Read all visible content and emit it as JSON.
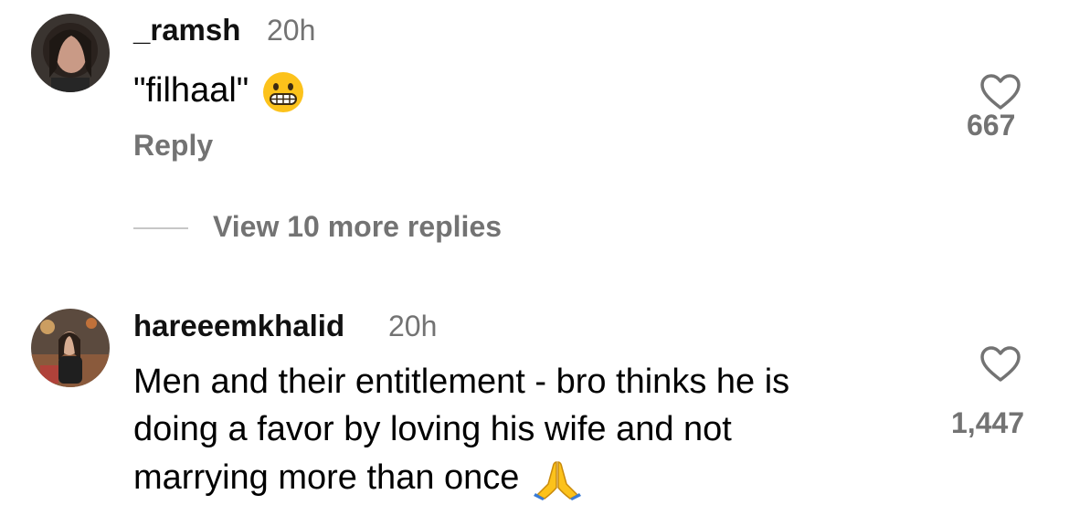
{
  "comments": [
    {
      "username": "_ramsh",
      "time": "20h",
      "lines": [
        "\"filhaal\""
      ],
      "emoji": "grimacing-face",
      "reply_label": "Reply",
      "likes": "667",
      "view_more": "View 10 more replies"
    },
    {
      "username": "hareeemkhalid",
      "time": "20h",
      "lines": [
        "Men and their entitlement - bro thinks he is",
        "doing a favor by loving his wife and not",
        "marrying more than once"
      ],
      "emoji": "folded-hands",
      "likes": "1,447"
    }
  ],
  "colors": {
    "secondary_text": "#737373",
    "primary_text": "#000000",
    "divider": "#c7c7c7"
  }
}
